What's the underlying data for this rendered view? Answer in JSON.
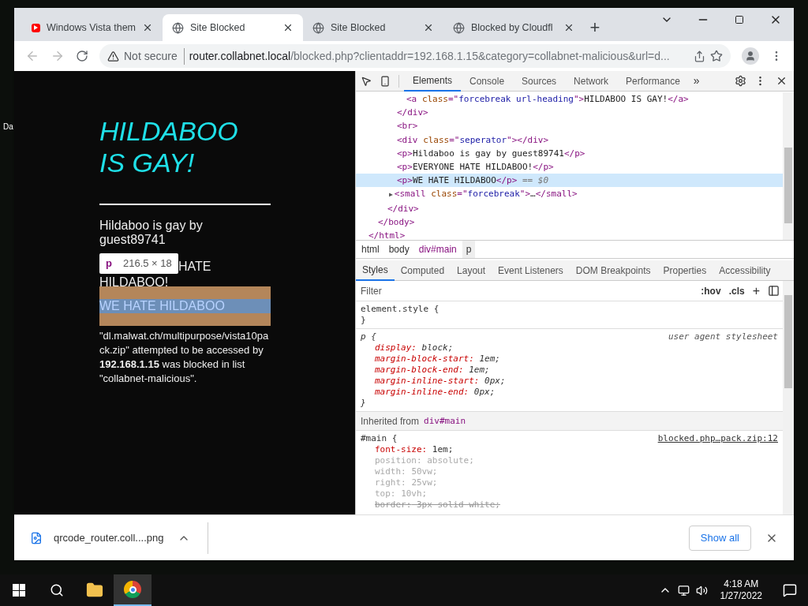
{
  "desktop": {
    "icon_label": "Da"
  },
  "browser": {
    "tabs": [
      {
        "title": "Windows Vista them",
        "kind": "video",
        "selected": false
      },
      {
        "title": "Site Blocked",
        "kind": "site",
        "selected": true
      },
      {
        "title": "Site Blocked",
        "kind": "site",
        "selected": false
      },
      {
        "title": "Blocked by Cloudfl",
        "kind": "site",
        "selected": false
      }
    ],
    "new_tab": "+",
    "security": "Not secure",
    "url_host": "router.collabnet.local",
    "url_path": "/blocked.php?clientaddr=192.168.1.15&category=collabnet-malicious&url=d..."
  },
  "page": {
    "heading": "HILDABOO IS GAY!",
    "para1": "Hildaboo is gay by guest89741",
    "para2_visible": "HATE",
    "para2_line2": "HILDABOO!",
    "highlighted": "WE HATE HILDABOO",
    "tooltip": {
      "tag": "p",
      "size": "216.5 × 18"
    },
    "notice": "\"dl.malwat.ch/multipurpose/vista10pack.zip\" attempted to be accessed by **192.168.1.15** was blocked in list \"collabnet-malicious\"."
  },
  "devtools": {
    "tabs": [
      {
        "label": "Elements",
        "selected": true
      },
      {
        "label": "Console",
        "selected": false
      },
      {
        "label": "Sources",
        "selected": false
      },
      {
        "label": "Network",
        "selected": false
      },
      {
        "label": "Performance",
        "selected": false
      }
    ],
    "more": "»",
    "dom": [
      {
        "selected": false,
        "parts": [
          {
            "kind": "tag",
            "text": "</html>"
          }
        ],
        "children": [
          {
            "selected": false,
            "parts": [
              {
                "kind": "tag",
                "text": "</body>"
              }
            ],
            "children": [
              {
                "selected": false,
                "parts": [
                  {
                    "kind": "tag",
                    "text": "</div>"
                  }
                ],
                "children": [
                  {
                    "selected": false,
                    "parts": [
                      {
                        "kind": "tag",
                        "text": "</div>"
                      }
                    ],
                    "children": [
                      {
                        "selected": false,
                        "parts": [
                          {
                            "kind": "tag",
                            "text": "<a "
                          },
                          {
                            "kind": "attr",
                            "text": "class"
                          },
                          {
                            "kind": "tag",
                            "text": "=\""
                          },
                          {
                            "kind": "value",
                            "text": "forcebreak url-heading"
                          },
                          {
                            "kind": "tag",
                            "text": "\">"
                          },
                          {
                            "kind": "text",
                            "text": "HILDABOO IS GAY!"
                          },
                          {
                            "kind": "tag",
                            "text": "</a>"
                          }
                        ]
                      }
                    ]
                  },
                  {
                    "selected": false,
                    "parts": [
                      {
                        "kind": "tag",
                        "text": "<br>"
                      }
                    ]
                  },
                  {
                    "selected": false,
                    "parts": [
                      {
                        "kind": "tag",
                        "text": "<div "
                      },
                      {
                        "kind": "attr",
                        "text": "class"
                      },
                      {
                        "kind": "tag",
                        "text": "=\""
                      },
                      {
                        "kind": "value",
                        "text": "seperator"
                      },
                      {
                        "kind": "tag",
                        "text": "\"></div>"
                      }
                    ]
                  },
                  {
                    "selected": false,
                    "parts": [
                      {
                        "kind": "tag",
                        "text": "<p>"
                      },
                      {
                        "kind": "text",
                        "text": "Hildaboo is gay by guest89741"
                      },
                      {
                        "kind": "tag",
                        "text": "</p>"
                      }
                    ]
                  },
                  {
                    "selected": false,
                    "parts": [
                      {
                        "kind": "tag",
                        "text": "<p>"
                      },
                      {
                        "kind": "text",
                        "text": "EVERYONE HATE HILDABOO!"
                      },
                      {
                        "kind": "tag",
                        "text": "</p>"
                      }
                    ]
                  },
                  {
                    "selected": true,
                    "parts": [
                      {
                        "kind": "tag",
                        "text": "<p>"
                      },
                      {
                        "kind": "text",
                        "text": "WE HATE HILDABOO"
                      },
                      {
                        "kind": "tag",
                        "text": "</p>"
                      },
                      {
                        "kind": "note",
                        "text": " == $0"
                      }
                    ]
                  },
                  {
                    "selected": false,
                    "expander": "▶",
                    "parts": [
                      {
                        "kind": "tag",
                        "text": "<small "
                      },
                      {
                        "kind": "attr",
                        "text": "class"
                      },
                      {
                        "kind": "tag",
                        "text": "=\""
                      },
                      {
                        "kind": "value",
                        "text": "forcebreak"
                      },
                      {
                        "kind": "tag",
                        "text": "\">"
                      },
                      {
                        "kind": "text",
                        "text": "…"
                      },
                      {
                        "kind": "tag",
                        "text": "</small>"
                      }
                    ]
                  }
                ]
              }
            ]
          }
        ]
      }
    ],
    "breadcrumbs": [
      {
        "label": "html",
        "selected": false
      },
      {
        "label": "body",
        "selected": false
      },
      {
        "label": "div#main",
        "selected": false
      },
      {
        "label": "p",
        "selected": true
      }
    ],
    "style_tabs": [
      {
        "label": "Styles",
        "selected": true
      },
      {
        "label": "Computed",
        "selected": false
      },
      {
        "label": "Layout",
        "selected": false
      },
      {
        "label": "Event Listeners",
        "selected": false
      },
      {
        "label": "DOM Breakpoints",
        "selected": false
      },
      {
        "label": "Properties",
        "selected": false
      },
      {
        "label": "Accessibility",
        "selected": false
      }
    ],
    "filter_placeholder": "Filter",
    "hov": ":hov",
    "cls": ".cls",
    "add": "+",
    "element_style": {
      "selector": "element.style {",
      "close": "}"
    },
    "ua_rule": {
      "selector": "p {",
      "source": "user agent stylesheet",
      "close": "}",
      "props": [
        {
          "name": "display:",
          "value": "block;"
        },
        {
          "name": "margin-block-start:",
          "value": "1em;"
        },
        {
          "name": "margin-block-end:",
          "value": "1em;"
        },
        {
          "name": "margin-inline-start:",
          "value": "0px;"
        },
        {
          "name": "margin-inline-end:",
          "value": "0px;"
        }
      ]
    },
    "inherited_label": "Inherited from",
    "inherited_from": "div#main",
    "main_rule": {
      "selector": "#main {",
      "source": "blocked.php…pack.zip:12",
      "props": [
        {
          "name": "font-size:",
          "value": "1em;",
          "inactive": false,
          "struck": false
        },
        {
          "name": "position:",
          "value": "absolute;",
          "inactive": true,
          "struck": false
        },
        {
          "name": "width:",
          "value": "50vw;",
          "inactive": true,
          "struck": false
        },
        {
          "name": "right:",
          "value": "25vw;",
          "inactive": true,
          "struck": false
        },
        {
          "name": "top:",
          "value": "10vh;",
          "inactive": true,
          "struck": false
        },
        {
          "name": "border:",
          "value": "3px solid white;",
          "inactive": false,
          "struck": true
        }
      ]
    }
  },
  "download": {
    "file": "qrcode_router.coll....png",
    "show_all": "Show all"
  },
  "taskbar": {
    "time": "4:18 AM",
    "date": "1/27/2022"
  }
}
